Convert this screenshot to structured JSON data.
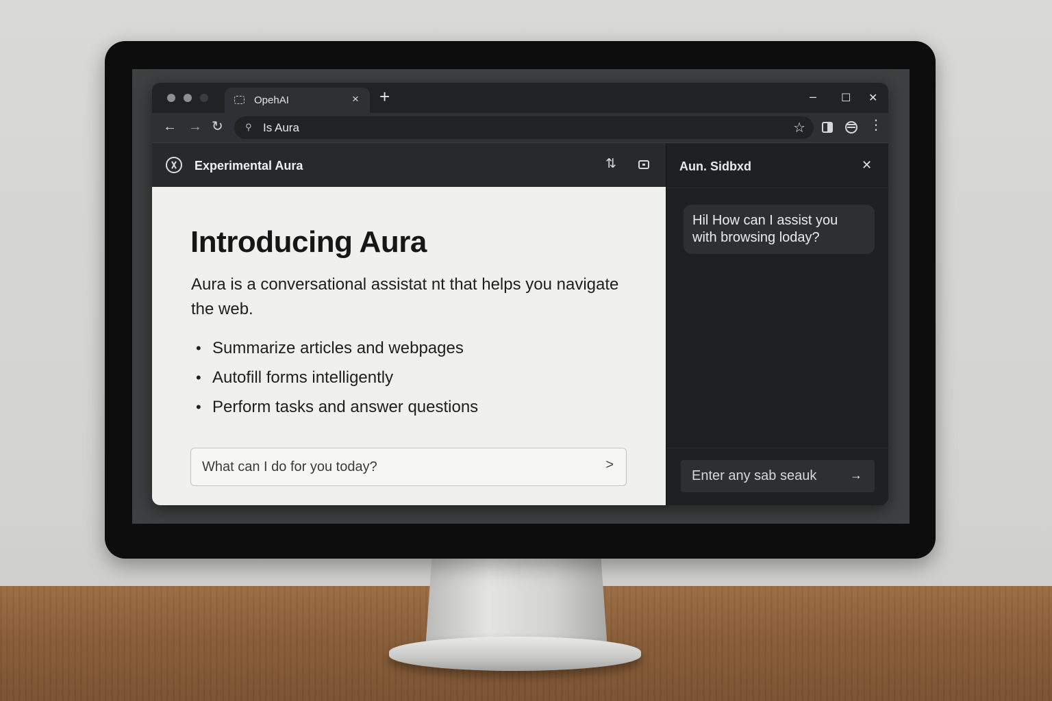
{
  "browser": {
    "tab_title": "OpehAI",
    "tab_close": "×",
    "new_tab": "+",
    "window_controls": {
      "minimize": "–",
      "maximize": "☐",
      "close": "✕"
    },
    "nav": {
      "back": "←",
      "forward": "→",
      "reload": "↻"
    },
    "address_text": "Is Aura",
    "icons": [
      "search-icon",
      "star-icon",
      "side-panel-icon",
      "profile-icon",
      "more-vert-icon"
    ]
  },
  "page": {
    "header_title": "Experimental Aura",
    "title": "Introducing Aura",
    "description": "Aura is a conversational assistat nt that helps you navigate the web.",
    "features": [
      "Summarize articles and webpages",
      "Autofill forms intelligently",
      "Perform tasks and answer questions"
    ],
    "prompt_placeholder": "What can I do for you today?",
    "prompt_send": ">"
  },
  "sidebar": {
    "title": "Aun. Sidbxd",
    "close": "✕",
    "message": "Hil How can I assist you with browsing loday?",
    "input_placeholder": "Enter any sab seauk",
    "send": "→"
  },
  "colors": {
    "page_bg": "#f0f0ef",
    "sidebar_bg": "#1e2122",
    "chrome_dark": "#202324",
    "chrome_toolbar": "#2e3133"
  }
}
